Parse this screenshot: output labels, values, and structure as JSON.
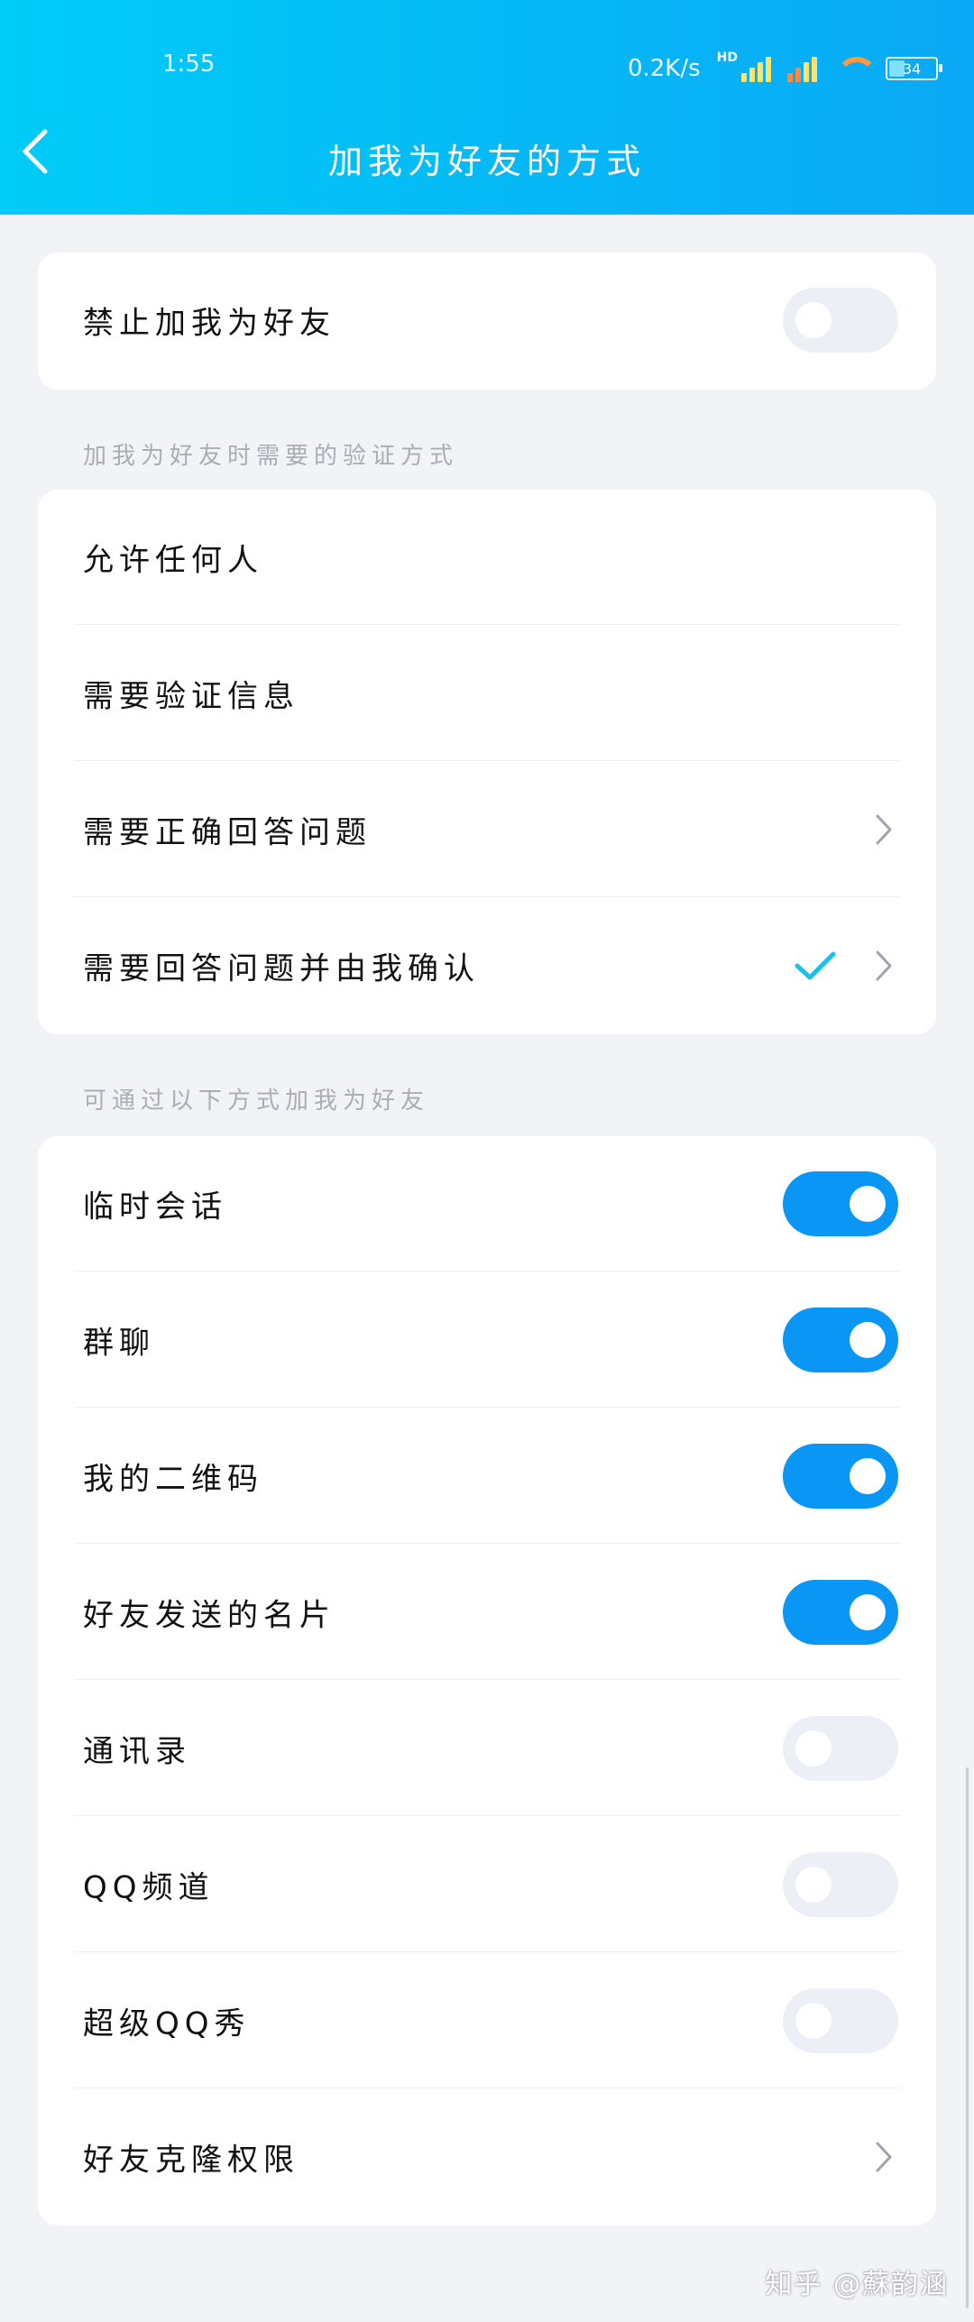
{
  "status_bar": {
    "time": "1:55",
    "speed": "0.2K/s",
    "hd_label": "HD",
    "battery": "34"
  },
  "header": {
    "title": "加我为好友的方式"
  },
  "section_block": {
    "label": "禁止加我为好友",
    "enabled": false
  },
  "verification": {
    "hint": "加我为好友时需要的验证方式",
    "items": [
      {
        "label": "允许任何人"
      },
      {
        "label": "需要验证信息"
      },
      {
        "label": "需要正确回答问题"
      },
      {
        "label": "需要回答问题并由我确认",
        "selected": true
      }
    ]
  },
  "channels": {
    "hint": "可通过以下方式加我为好友",
    "items": [
      {
        "label": "临时会话",
        "enabled": true
      },
      {
        "label": "群聊",
        "enabled": true
      },
      {
        "label": "我的二维码",
        "enabled": true
      },
      {
        "label": "好友发送的名片",
        "enabled": true
      },
      {
        "label": "通讯录",
        "enabled": false
      },
      {
        "label": "QQ频道",
        "enabled": false
      },
      {
        "label": "超级QQ秀",
        "enabled": false
      },
      {
        "label": "好友克隆权限"
      }
    ]
  },
  "watermark": "知乎 @蘇韵涵",
  "colors": {
    "header_start": "#00ccf7",
    "header_end": "#0aa8f5",
    "toggle_on": "#0a96f5",
    "check": "#1cc0ea"
  }
}
